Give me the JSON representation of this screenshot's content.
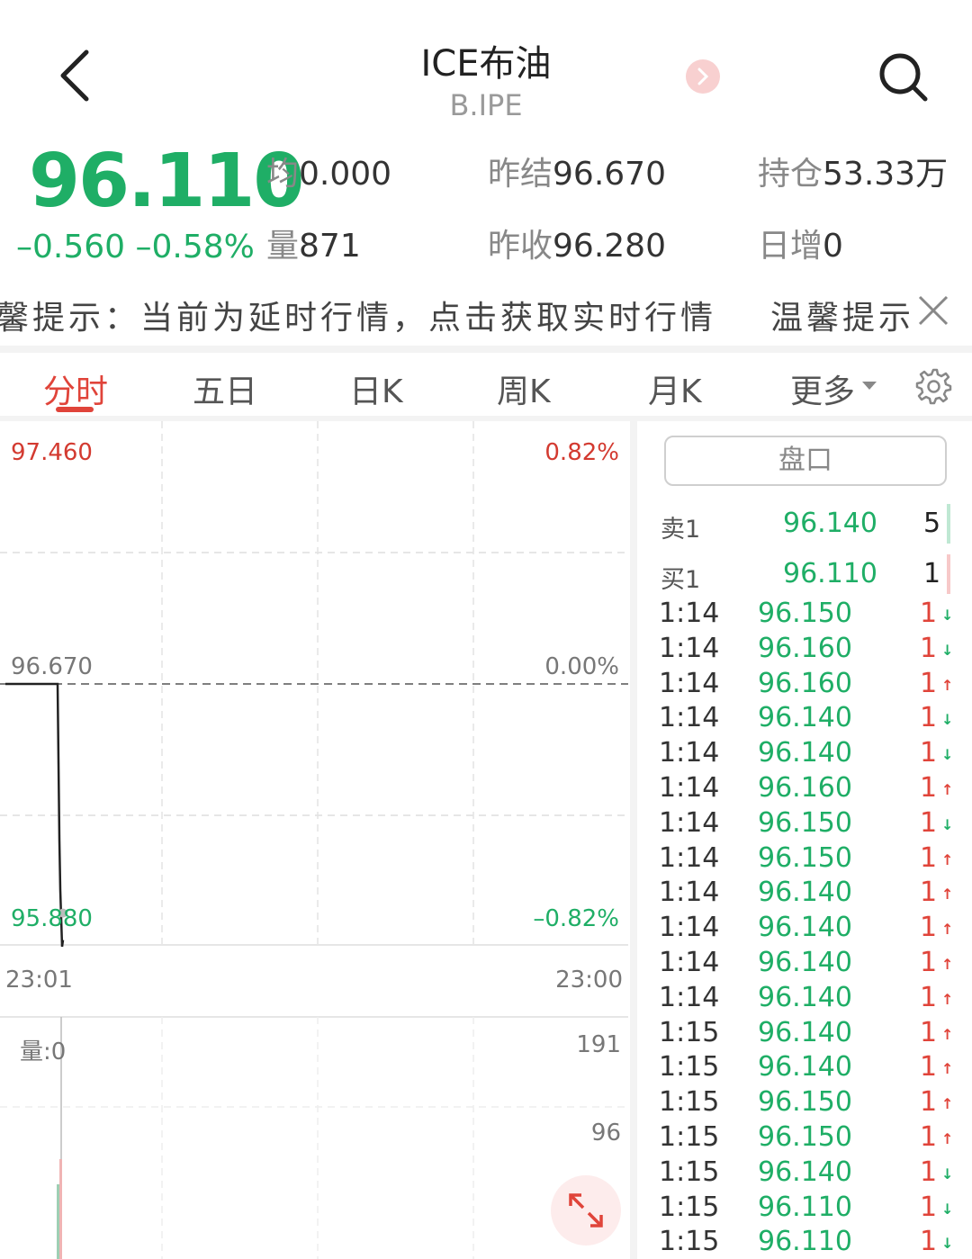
{
  "header": {
    "title": "ICE布油",
    "subtitle": "B.IPE"
  },
  "quote": {
    "last_price": "96.110",
    "change": "–0.560",
    "change_pct": "–0.58%",
    "stats": [
      {
        "label": "均",
        "value": "0.000"
      },
      {
        "label": "昨结",
        "value": "96.670"
      },
      {
        "label": "持仓",
        "value": "53.33万"
      },
      {
        "label": "量",
        "value": "871"
      },
      {
        "label": "昨收",
        "value": "96.280"
      },
      {
        "label": "日增",
        "value": "0"
      }
    ]
  },
  "notice": {
    "text": "馨提示：当前为延时行情，点击获取实时行情",
    "title": "温馨提示"
  },
  "tabs": [
    {
      "label": "分时",
      "active": true
    },
    {
      "label": "五日",
      "active": false
    },
    {
      "label": "日K",
      "active": false
    },
    {
      "label": "周K",
      "active": false
    },
    {
      "label": "月K",
      "active": false
    },
    {
      "label": "更多",
      "active": false
    }
  ],
  "chart": {
    "y_top": "97.460",
    "y_mid": "96.670",
    "y_bottom": "95.880",
    "pct_top": "0.82%",
    "pct_mid": "0.00%",
    "pct_bottom": "–0.82%",
    "time_start": "23:01",
    "time_end": "23:00",
    "volume_label": "量:0",
    "vol_top": "191",
    "vol_mid": "96"
  },
  "chart_data": {
    "type": "line",
    "ylim": [
      95.88,
      97.46
    ],
    "reference": 96.67,
    "series": [
      {
        "values": [
          96.67,
          96.67,
          96.67,
          96.67,
          96.67,
          96.2,
          96.05,
          95.88,
          95.9
        ]
      }
    ]
  },
  "order_book": {
    "button_label": "盘口",
    "rows": [
      {
        "label": "卖1",
        "price": "96.140",
        "qty": "5",
        "bar_color": "#bfe8d3"
      },
      {
        "label": "买1",
        "price": "96.110",
        "qty": "1",
        "bar_color": "#f7c9c9"
      }
    ]
  },
  "ticks": [
    {
      "time": "1:14",
      "price": "96.150",
      "vol": "1",
      "dir": "↓"
    },
    {
      "time": "1:14",
      "price": "96.160",
      "vol": "1",
      "dir": "↓"
    },
    {
      "time": "1:14",
      "price": "96.160",
      "vol": "1",
      "dir": "↑"
    },
    {
      "time": "1:14",
      "price": "96.140",
      "vol": "1",
      "dir": "↓"
    },
    {
      "time": "1:14",
      "price": "96.140",
      "vol": "1",
      "dir": "↓"
    },
    {
      "time": "1:14",
      "price": "96.160",
      "vol": "1",
      "dir": "↑"
    },
    {
      "time": "1:14",
      "price": "96.150",
      "vol": "1",
      "dir": "↓"
    },
    {
      "time": "1:14",
      "price": "96.150",
      "vol": "1",
      "dir": "↑"
    },
    {
      "time": "1:14",
      "price": "96.140",
      "vol": "1",
      "dir": "↑"
    },
    {
      "time": "1:14",
      "price": "96.140",
      "vol": "1",
      "dir": "↑"
    },
    {
      "time": "1:14",
      "price": "96.140",
      "vol": "1",
      "dir": "↑"
    },
    {
      "time": "1:14",
      "price": "96.140",
      "vol": "1",
      "dir": "↑"
    },
    {
      "time": "1:15",
      "price": "96.140",
      "vol": "1",
      "dir": "↑"
    },
    {
      "time": "1:15",
      "price": "96.140",
      "vol": "1",
      "dir": "↑"
    },
    {
      "time": "1:15",
      "price": "96.150",
      "vol": "1",
      "dir": "↑"
    },
    {
      "time": "1:15",
      "price": "96.150",
      "vol": "1",
      "dir": "↑"
    },
    {
      "time": "1:15",
      "price": "96.140",
      "vol": "1",
      "dir": "↓"
    },
    {
      "time": "1:15",
      "price": "96.110",
      "vol": "1",
      "dir": "↓"
    },
    {
      "time": "1:15",
      "price": "96.110",
      "vol": "1",
      "dir": "↓"
    }
  ],
  "colors": {
    "up": "#e0443a",
    "down": "#1fae66"
  }
}
